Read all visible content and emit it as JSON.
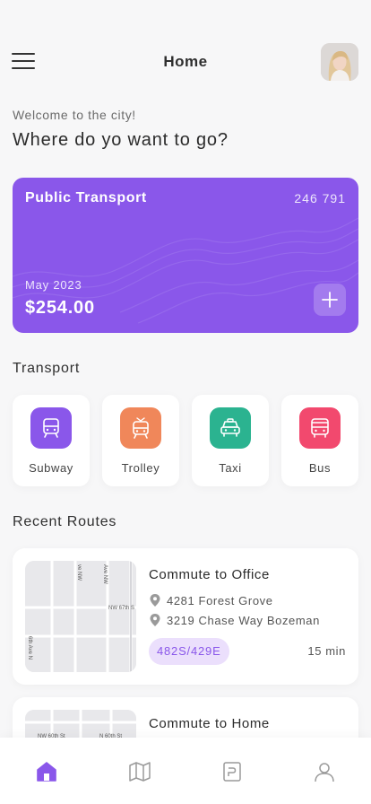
{
  "header": {
    "title": "Home"
  },
  "intro": {
    "welcome": "Welcome to the city!",
    "headline": "Where do yo want to go?"
  },
  "card": {
    "title": "Public Transport",
    "number": "246 791",
    "date": "May 2023",
    "amount": "$254.00",
    "color": "#8a57ea"
  },
  "transport": {
    "title": "Transport",
    "items": [
      {
        "label": "Subway",
        "icon": "subway-icon",
        "color": "#8a57ea"
      },
      {
        "label": "Trolley",
        "icon": "trolley-icon",
        "color": "#f0875a"
      },
      {
        "label": "Taxi",
        "icon": "taxi-icon",
        "color": "#2bb390"
      },
      {
        "label": "Bus",
        "icon": "bus-icon",
        "color": "#f2496e"
      }
    ]
  },
  "routes": {
    "title": "Recent Routes",
    "items": [
      {
        "title": "Commute to Office",
        "from": "4281 Forest Grove",
        "to": "3219 Chase Way Bozeman",
        "code": "482S/429E",
        "duration": "15 min",
        "map_labels": [
          "ve NW",
          "Ave NW",
          "NW 67th S",
          "6th Ave N"
        ]
      },
      {
        "title": "Commute to Home",
        "map_labels": [
          "NW 60th St",
          "N 60th St"
        ]
      }
    ]
  },
  "nav": {
    "items": [
      {
        "icon": "home-icon",
        "active": true
      },
      {
        "icon": "map-icon",
        "active": false
      },
      {
        "icon": "ticket-icon",
        "active": false
      },
      {
        "icon": "profile-icon",
        "active": false
      }
    ],
    "active_color": "#8a57ea"
  }
}
